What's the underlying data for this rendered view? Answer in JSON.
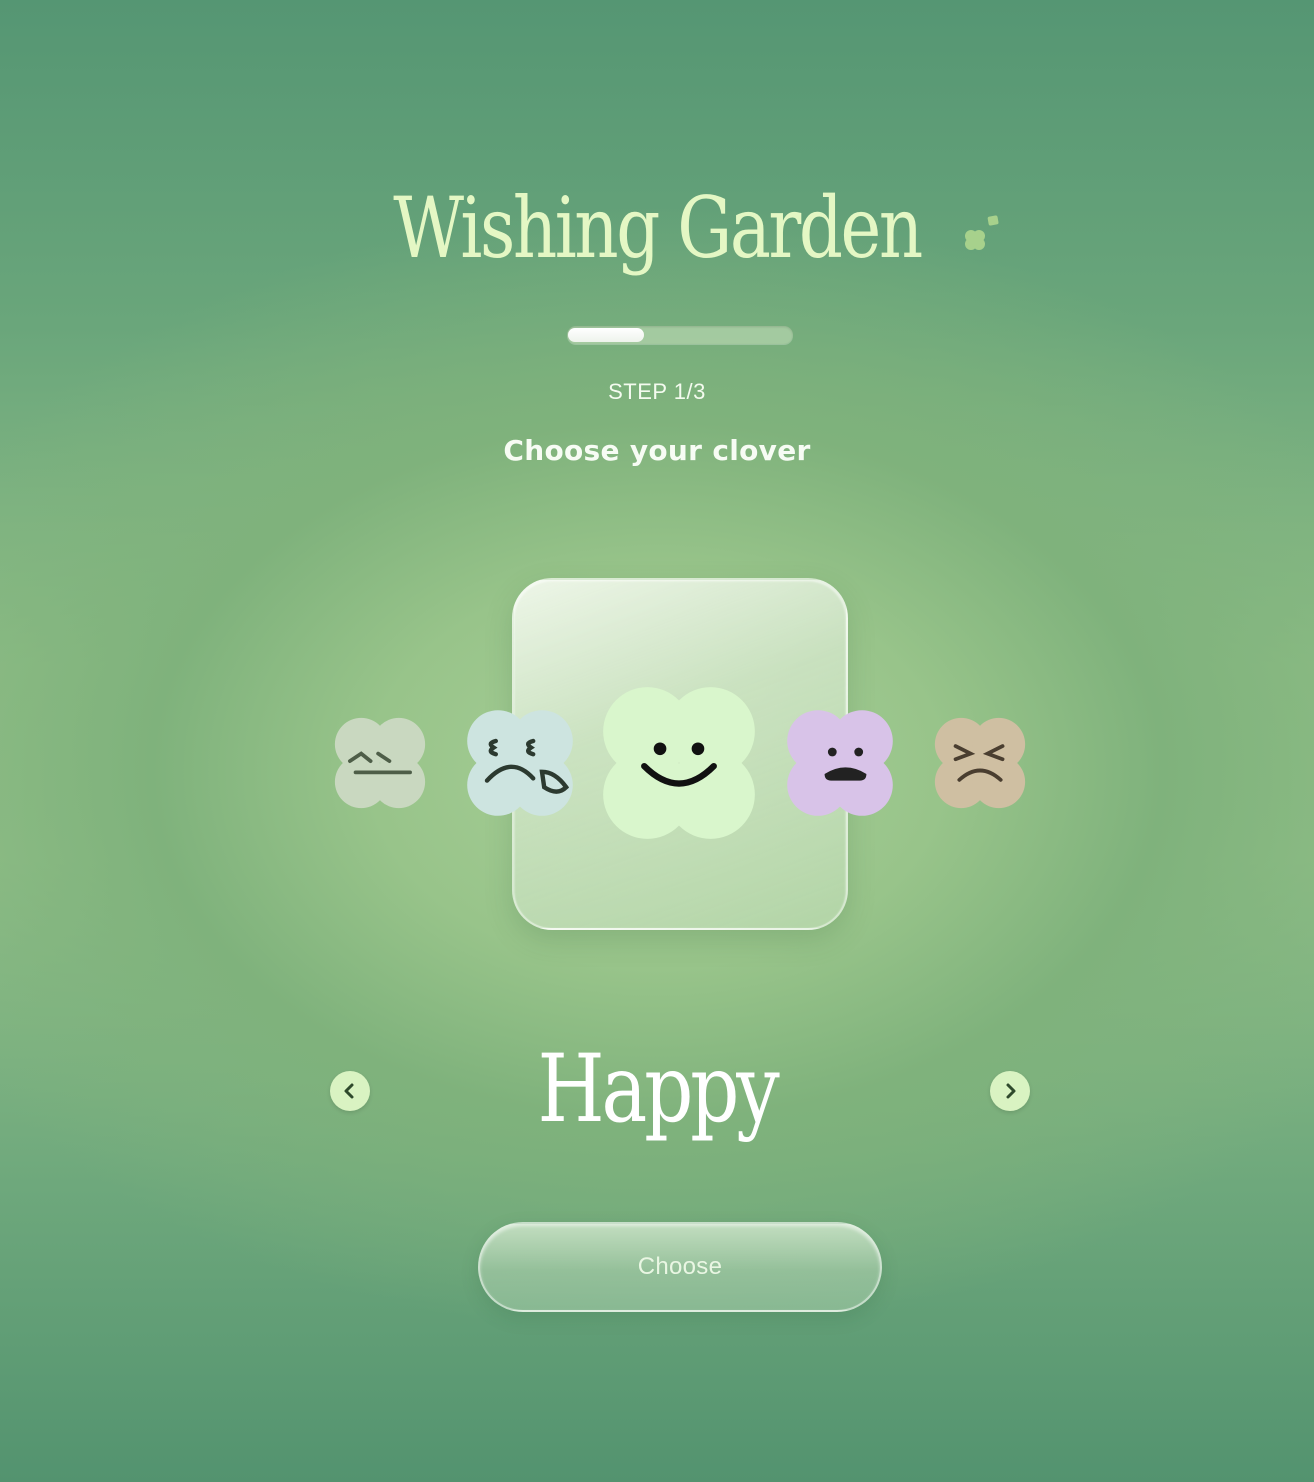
{
  "app": {
    "title": "Wishing Garden"
  },
  "progress": {
    "step_label": "STEP 1/3",
    "fraction": 0.34
  },
  "prompt": {
    "subtitle": "Choose your clover"
  },
  "carousel": {
    "selected_index": 2,
    "selected_label": "Happy",
    "clovers": [
      {
        "mood": "calm",
        "color": "#c9d8c0",
        "icon": "calm-face-icon"
      },
      {
        "mood": "sad",
        "color": "#cde4e0",
        "icon": "crying-face-icon"
      },
      {
        "mood": "happy",
        "color": "#d9f6cc",
        "icon": "smile-face-icon"
      },
      {
        "mood": "worried",
        "color": "#d8c3e8",
        "icon": "worried-face-icon"
      },
      {
        "mood": "angry",
        "color": "#cfbfa2",
        "icon": "angry-face-icon"
      }
    ]
  },
  "actions": {
    "choose_label": "Choose"
  },
  "colors": {
    "accent": "#e4f7c4",
    "nav_button": "#d9f3c2",
    "nav_arrow": "#2f4a2c",
    "face_ink": "#1f2a1c"
  }
}
